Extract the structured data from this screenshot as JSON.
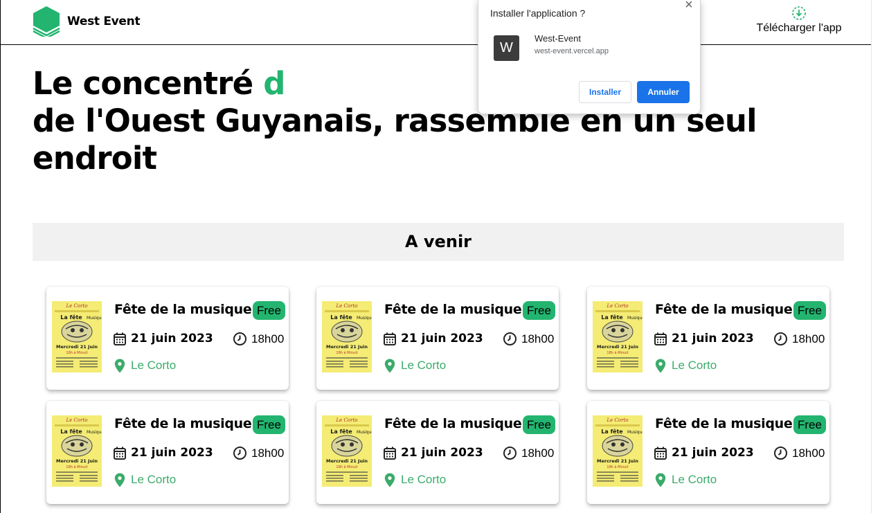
{
  "header": {
    "brand": "West Event",
    "download_label": "Télécharger l'app",
    "download_icon": "download-circle-icon",
    "accent_color": "#23b46f"
  },
  "hero": {
    "line1_prefix": "Le concentré ",
    "line1_accent": "d",
    "line2": "de l'Ouest Guyanais, rassemblé en un seul",
    "line3": "endroit"
  },
  "section": {
    "title": "A venir"
  },
  "events": [
    {
      "title": "Fête de la musique",
      "badge": "Free",
      "date": "21 juin 2023",
      "time": "18h00",
      "place": "Le Corto"
    },
    {
      "title": "Fête de la musique",
      "badge": "Free",
      "date": "21 juin 2023",
      "time": "18h00",
      "place": "Le Corto"
    },
    {
      "title": "Fête de la musique",
      "badge": "Free",
      "date": "21 juin 2023",
      "time": "18h00",
      "place": "Le Corto"
    },
    {
      "title": "Fête de la musique",
      "badge": "Free",
      "date": "21 juin 2023",
      "time": "18h00",
      "place": "Le Corto"
    },
    {
      "title": "Fête de la musique",
      "badge": "Free",
      "date": "21 juin 2023",
      "time": "18h00",
      "place": "Le Corto"
    },
    {
      "title": "Fête de la musique",
      "badge": "Free",
      "date": "21 juin 2023",
      "time": "18h00",
      "place": "Le Corto"
    }
  ],
  "install_dialog": {
    "title": "Installer l'application ?",
    "close_icon": "close-icon",
    "app_initial": "W",
    "app_name": "West-Event",
    "app_url": "west-event.vercel.app",
    "install_label": "Installer",
    "cancel_label": "Annuler"
  },
  "colors": {
    "accent": "#23b46f",
    "place_link": "#3bab6a",
    "primary_button": "#1a73e8",
    "section_bg": "#f1f1f1"
  }
}
